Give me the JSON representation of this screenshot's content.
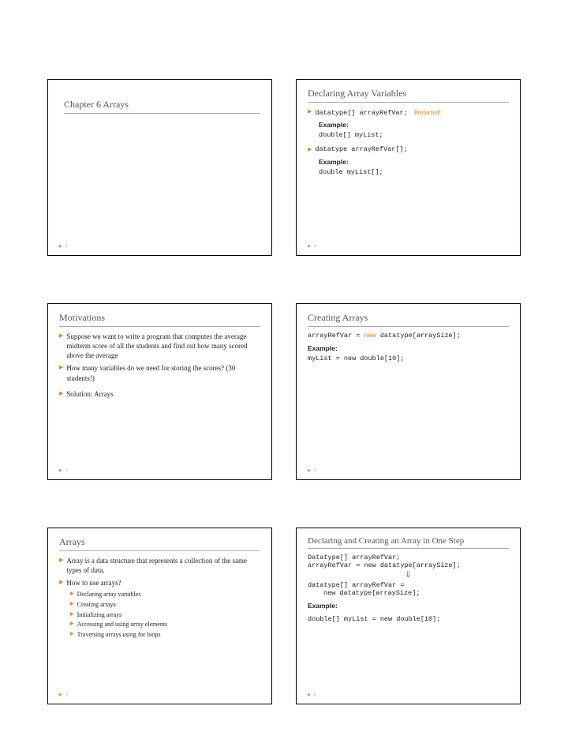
{
  "slide1": {
    "title": "Chapter 6 Arrays",
    "page": "1"
  },
  "slide2": {
    "title": "Motivations",
    "b1": "Suppose we want to write a program that computes the average midterm score of all the students and find out how many scored above the average",
    "b2": "How many variables do we need for storing the scores? (30 students!)",
    "b3": "Solution: Arrays",
    "page": "2"
  },
  "slide3": {
    "title": "Arrays",
    "b1": "Array is a data structure that represents a collection of the same types of data.",
    "b2": "How to use arrays?",
    "s1": "Declaring array variables",
    "s2": "Creating arrays",
    "s3": "Initializing arrays",
    "s4": "Accessing and using array elements",
    "s5": "Traversing arrays using for loops",
    "page": "3"
  },
  "slide4": {
    "title": "Declaring Array Variables",
    "c1": "datatype[] arrayRefVar;",
    "pref": "Preferred!",
    "ex": "Example:",
    "c2": "double[] myList;",
    "c3": "datatype arrayRefVar[];",
    "c4": "double myList[];",
    "page": "4"
  },
  "slide5": {
    "title": "Creating Arrays",
    "c1a": "arrayRefVar = ",
    "c1b": "new",
    "c1c": " datatype[arraySize];",
    "ex": "Example:",
    "c2": "myList = new double[10];",
    "page": "5"
  },
  "slide6": {
    "title": "Declaring and Creating an Array in One Step",
    "c1": "Datatype[] arrayRefVar;",
    "c2": "arrayRefVar = new datatype[arraySize];",
    "c3": "datatype[] arrayRefVar =",
    "c4": "new datatype[arraySize];",
    "ex": "Example:",
    "c5": "double[] myList = new double[10];",
    "page": "6"
  }
}
